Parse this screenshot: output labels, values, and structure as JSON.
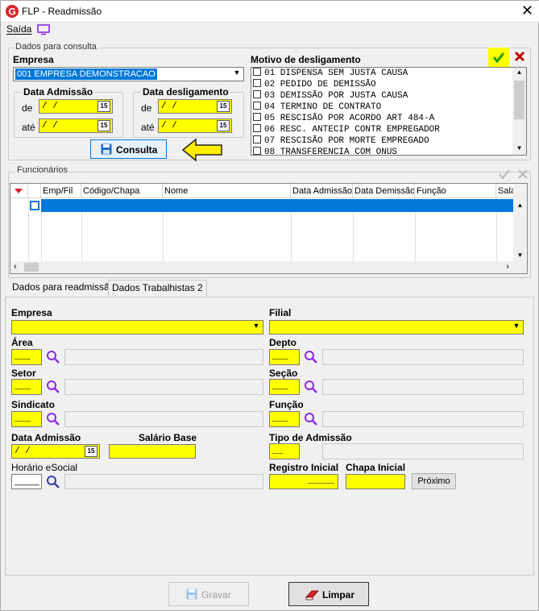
{
  "window": {
    "title": "FLP - Readmissão",
    "close_glyph": "✕"
  },
  "menu": {
    "saida": "Saída"
  },
  "consulta": {
    "group_title": "Dados para consulta",
    "empresa_label": "Empresa",
    "empresa_value": "001 EMPRESA DEMONSTRACAO",
    "admissao_title": "Data Admissão",
    "desligamento_title": "Data desligamento",
    "de_label": "de",
    "ate_label": "até",
    "date_empty": " / /",
    "cal_label": "15",
    "consulta_button": "Consulta",
    "motivo_label": "Motivo de desligamento",
    "motivos": [
      "01 DISPENSA SEM JUSTA CAUSA",
      "02 PEDIDO DE DEMISSÃO",
      "03 DEMISSÃO POR JUSTA CAUSA",
      "04 TERMINO DE CONTRATO",
      "05 RESCISÃO POR ACORDO ART 484-A",
      "06 RESC. ANTECIP CONTR EMPREGADOR",
      "07 RESCISÃO POR MORTE EMPREGADO",
      "08 TRANSFERENCIA COM ONUS"
    ]
  },
  "funcionarios": {
    "group_title": "Funcionários",
    "columns": [
      "Emp/Fil",
      "Código/Chapa",
      "Nome",
      "Data Admissão",
      "Data Demissão",
      "Função",
      "Sala"
    ]
  },
  "tabs": [
    "Dados para readmissão",
    "Dados Trabalhistas 2"
  ],
  "form": {
    "empresa": "Empresa",
    "filial": "Filial",
    "area": "Área",
    "depto": "Depto",
    "setor": "Setor",
    "secao": "Seção",
    "sindicato": "Sindicato",
    "funcao": "Função",
    "data_admissao": "Data Admissão",
    "salario_base": "Salário Base",
    "tipo_admissao": "Tipo de Admissão",
    "horario_esocial": "Horário eSocial",
    "registro_inicial": "Registro Inicial",
    "chapa_inicial": "Chapa Inicial",
    "proximo": "Próximo",
    "short_blank": "___",
    "tipo_blank": "__",
    "reg_blank": "_____",
    "date_empty": " / /"
  },
  "footer": {
    "gravar": "Gravar",
    "limpar": "Limpar"
  },
  "colors": {
    "yellow": "#ffff00",
    "selection": "#0078d7",
    "accent_check": "#1e9e1e",
    "accent_x": "#c00000"
  }
}
